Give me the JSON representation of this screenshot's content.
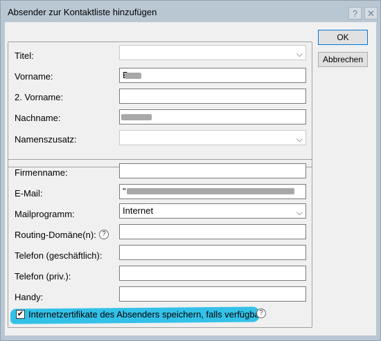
{
  "window": {
    "title": "Absender zur Kontaktliste hinzufügen",
    "help_button": "?",
    "close_button": "✕"
  },
  "buttons": {
    "ok": "OK",
    "cancel": "Abbrechen"
  },
  "name_group": {
    "title_label": "Titel:",
    "title_value": "",
    "first_name_label": "Vorname:",
    "first_name_value": "B",
    "middle_name_label": "2. Vorname:",
    "middle_name_value": "",
    "last_name_label": "Nachname:",
    "last_name_value": "",
    "suffix_label": "Namenszusatz:",
    "suffix_value": ""
  },
  "contact_group": {
    "company_label": "Firmenname:",
    "company_value": "",
    "email_label": "E-Mail:",
    "email_value": "\"",
    "mail_program_label": "Mailprogramm:",
    "mail_program_value": "Internet",
    "routing_label": "Routing-Domäne(n):",
    "routing_value": "",
    "phone_work_label": "Telefon (geschäftlich):",
    "phone_work_value": "",
    "phone_private_label": "Telefon (priv.):",
    "phone_private_value": "",
    "mobile_label": "Handy:",
    "mobile_value": "",
    "cert_checkbox_checked": true,
    "cert_checkbox_label": "Internetzertifikate des Absenders speichern, falls verfügbar"
  },
  "icons": {
    "help": "?",
    "check": "✔",
    "chevron": "⌵"
  },
  "colors": {
    "highlight": "#33c1e8",
    "frame": "#b9c7d3",
    "client": "#f0f0f0"
  }
}
